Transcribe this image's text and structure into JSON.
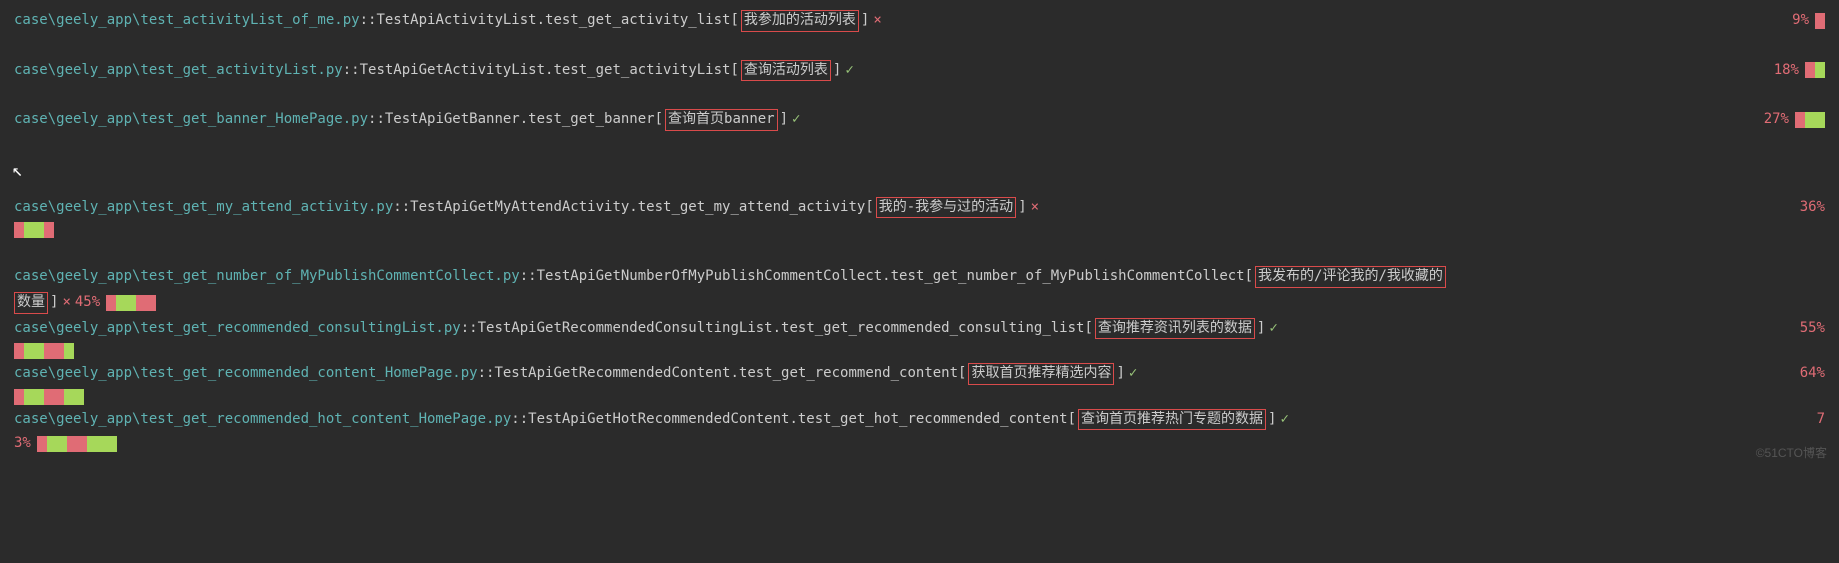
{
  "cursor_glyph": "➤",
  "tests": [
    {
      "path": "case\\geely_app\\test_activityList_of_me.py",
      "test": "TestApiActivityList.test_get_activity_list",
      "desc": "我参加的活动列表",
      "status": "fail",
      "status_mark": "×",
      "percent": "9%",
      "bars": [
        "red"
      ]
    },
    {
      "path": "case\\geely_app\\test_get_activityList.py",
      "test": "TestApiGetActivityList.test_get_activityList",
      "desc": "查询活动列表",
      "status": "pass",
      "status_mark": "✓",
      "percent": "18%",
      "bars": [
        "red",
        "green"
      ]
    },
    {
      "path": "case\\geely_app\\test_get_banner_HomePage.py",
      "test": "TestApiGetBanner.test_get_banner",
      "desc": "查询首页banner",
      "status": "pass",
      "status_mark": "✓",
      "percent": "27%",
      "bars": [
        "red",
        "green",
        "green"
      ]
    },
    {
      "path": "case\\geely_app\\test_get_my_attend_activity.py",
      "test": "TestApiGetMyAttendActivity.test_get_my_attend_activity",
      "desc": "我的-我参与过的活动",
      "status": "fail",
      "status_mark": "×",
      "percent": "36%",
      "bars_below": [
        "red",
        "green",
        "green",
        "red"
      ]
    },
    {
      "path": "case\\geely_app\\test_get_number_of_MyPublishCommentCollect.py",
      "test": "TestApiGetNumberOfMyPublishCommentCollect.test_get_number_of_MyPublishCommentCollect",
      "desc": "我发布的/评论我的/我收藏的数量",
      "wrap_tail": "数量]",
      "status": "fail",
      "inline_status_mark": "×",
      "inline_percent": "45%",
      "bars_inline": [
        "red",
        "green",
        "green",
        "red",
        "red"
      ]
    },
    {
      "path": "case\\geely_app\\test_get_recommended_consultingList.py",
      "test": "TestApiGetRecommendedConsultingList.test_get_recommended_consulting_list",
      "desc": "查询推荐资讯列表的数据",
      "status": "pass",
      "status_mark": "✓",
      "percent": "55%",
      "bars_below": [
        "red",
        "green",
        "green",
        "red",
        "red",
        "green"
      ]
    },
    {
      "path": "case\\geely_app\\test_get_recommended_content_HomePage.py",
      "test": "TestApiGetRecommendedContent.test_get_recommend_content",
      "desc": "获取首页推荐精选内容",
      "status": "pass",
      "status_mark": "✓",
      "percent": "64%",
      "bars_below": [
        "red",
        "green",
        "green",
        "red",
        "red",
        "green",
        "green"
      ]
    },
    {
      "path": "case\\geely_app\\test_get_recommended_hot_content_HomePage.py",
      "test": "TestApiGetHotRecommendedContent.test_get_hot_recommended_content",
      "desc": "查询首页推荐热门专题的数据",
      "status": "pass",
      "status_mark": "✓",
      "percent_right": "7",
      "wrap_percent": "3%",
      "bars_wrap": [
        "red",
        "green",
        "green",
        "red",
        "red",
        "green",
        "green",
        "green"
      ]
    }
  ],
  "watermark": "©51CTO博客"
}
